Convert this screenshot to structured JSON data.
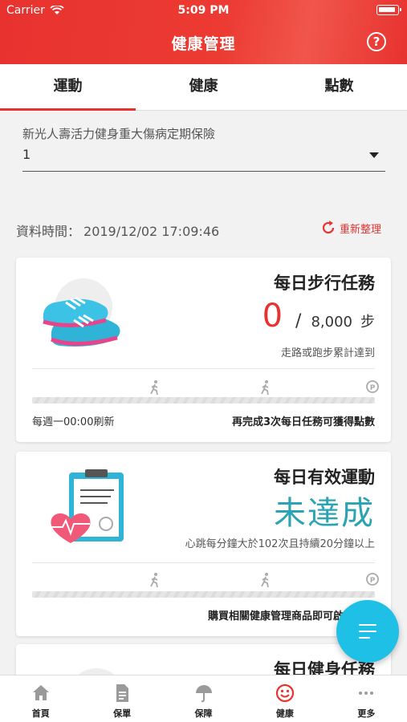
{
  "status_bar": {
    "carrier": "Carrier",
    "time": "5:09 PM"
  },
  "header": {
    "title": "健康管理",
    "help_icon": "question-circle-icon"
  },
  "tabs": [
    {
      "label": "運動",
      "active": true
    },
    {
      "label": "健康",
      "active": false
    },
    {
      "label": "點數",
      "active": false
    }
  ],
  "policy": {
    "label": "新光人壽活力健身重大傷病定期保險",
    "selected": "1"
  },
  "data_time": {
    "label": "資料時間：",
    "value": "2019/12/02 17:09:46",
    "refresh_label": "重新整理"
  },
  "cards": {
    "steps": {
      "title": "每日步行任務",
      "current": "0",
      "slash": "/",
      "target": "8,000",
      "unit": "步",
      "desc": "走路或跑步累計達到",
      "progress": 0,
      "foot_left": "每週一00:00刷新",
      "foot_right": "再完成3次每日任務可獲得點數"
    },
    "exercise": {
      "title": "每日有效運動",
      "status": "未達成",
      "desc": "心跳每分鐘大於102次且持續20分鐘以上",
      "progress": 0,
      "foot_right": "購買相關健康管理商品即可啟動任務"
    },
    "fitness": {
      "title": "每日健身任務"
    }
  },
  "bottom_nav": [
    {
      "label": "首頁",
      "icon": "home-icon",
      "active": false
    },
    {
      "label": "保單",
      "icon": "document-icon",
      "active": false
    },
    {
      "label": "保障",
      "icon": "umbrella-icon",
      "active": false
    },
    {
      "label": "健康",
      "icon": "smile-icon",
      "active": true
    },
    {
      "label": "更多",
      "icon": "more-dots-icon",
      "active": false
    }
  ],
  "colors": {
    "brand_red": "#e8322f",
    "accent_teal": "#2aa3b3",
    "fab_blue": "#1ec0e6"
  }
}
